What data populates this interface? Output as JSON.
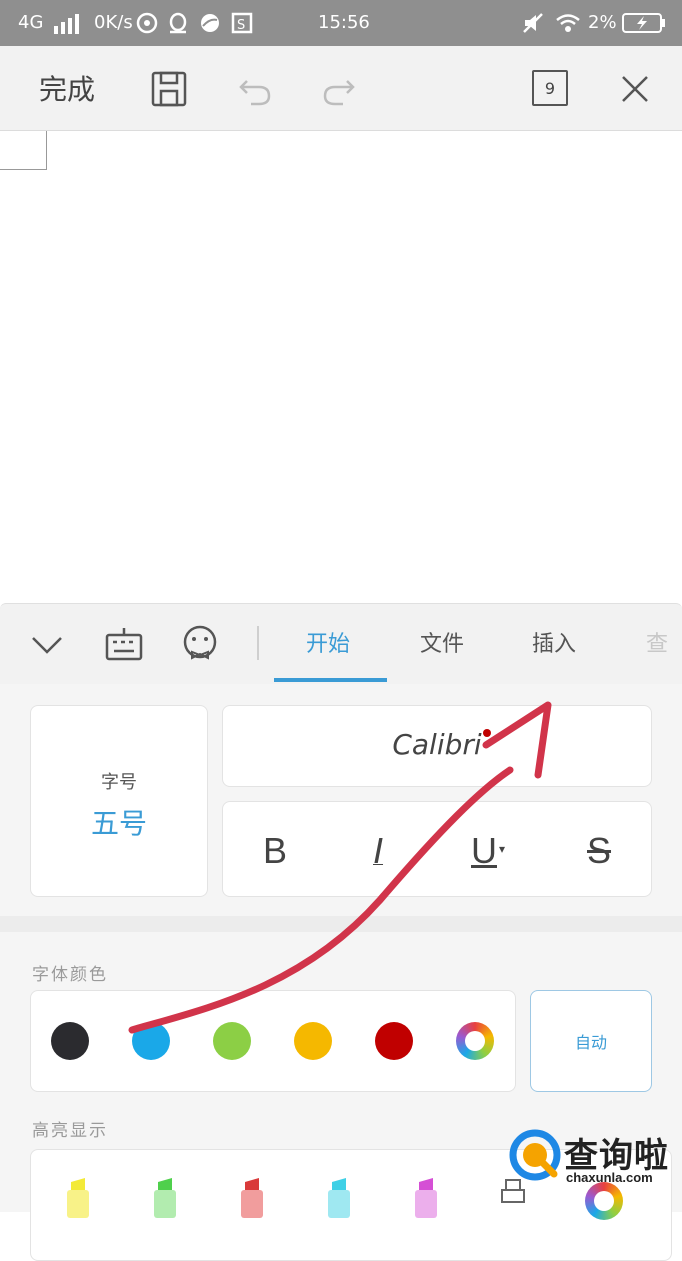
{
  "status_bar": {
    "network": "4G",
    "speed": "0K/s",
    "time": "15:56",
    "battery": "2%"
  },
  "toolbar": {
    "done_label": "完成",
    "page_count": "9",
    "icons": [
      "save-icon",
      "undo-icon",
      "redo-icon",
      "page-count-icon",
      "close-icon"
    ]
  },
  "ribbon": {
    "icons": [
      "chevron-down-icon",
      "keyboard-icon",
      "emoji-icon"
    ],
    "tabs": [
      "开始",
      "文件",
      "插入",
      "查"
    ],
    "active_tab": "开始",
    "accent_color": "#3a9bd5"
  },
  "font_panel": {
    "size_label": "字号",
    "size_value": "五号",
    "font_name": "Calibri",
    "format_buttons": [
      "B",
      "I",
      "U",
      "S"
    ]
  },
  "font_color": {
    "label": "字体颜色",
    "swatches": [
      "#2b2b2f",
      "#1aa8e8",
      "#8ccf45",
      "#f5b800",
      "#c00000",
      "color-wheel"
    ],
    "auto_label": "自动"
  },
  "highlight": {
    "label": "高亮显示",
    "colors": [
      "#f3ea38",
      "#7ee07a",
      "#e85b5b",
      "#5fd8e8",
      "#e07ae0",
      "eraser",
      "color-wheel"
    ]
  },
  "watermark": {
    "name": "查询啦",
    "url": "chaxunla.com"
  }
}
